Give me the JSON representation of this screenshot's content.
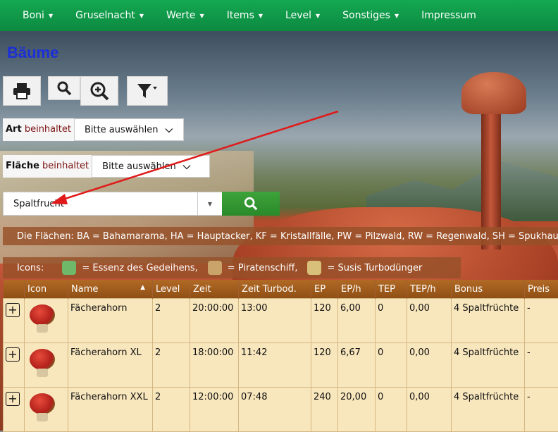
{
  "nav": {
    "items": [
      {
        "label": "Boni",
        "caret": true
      },
      {
        "label": "Gruselnacht",
        "caret": true
      },
      {
        "label": "Werte",
        "caret": true
      },
      {
        "label": "Items",
        "caret": true
      },
      {
        "label": "Level",
        "caret": true
      },
      {
        "label": "Sonstiges",
        "caret": true
      },
      {
        "label": "Impressum",
        "caret": false
      }
    ]
  },
  "page": {
    "title": "Bäume"
  },
  "toolbar": {
    "icons": [
      "print-icon",
      "search-icon",
      "zoom-in-icon",
      "filter-icon"
    ]
  },
  "filters": {
    "art": {
      "field": "Art",
      "op": "beinhaltet",
      "value": "Bitte auswählen"
    },
    "flaeche": {
      "field": "Fläche",
      "op": "beinhaltet",
      "value": "Bitte auswählen"
    }
  },
  "search": {
    "value": "Spaltfrucht"
  },
  "info": {
    "flaechen": "Die Flächen: BA = Bahamarama, HA = Hauptacker, KF = Kristallfälle, PW = Pilzwald, RW = Regenwald, SH = Spukhaus"
  },
  "icons_legend": {
    "label": "Icons:",
    "entries": [
      {
        "text": "= Essenz des Gedeihens,",
        "icon": "essence-icon",
        "color": "#6fb86a"
      },
      {
        "text": "= Piratenschiff,",
        "icon": "pirate-ship-icon",
        "color": "#c9a36a"
      },
      {
        "text": "= Susis Turbodünger",
        "icon": "fertilizer-icon",
        "color": "#d8c07a"
      }
    ]
  },
  "table": {
    "columns": [
      "",
      "Icon",
      "Name",
      "Level",
      "Zeit",
      "Zeit Turbod.",
      "EP",
      "EP/h",
      "TEP",
      "TEP/h",
      "Bonus",
      "Preis"
    ],
    "sort_column": "Name",
    "rows": [
      {
        "name": "Fächerahorn",
        "level": "2",
        "zeit": "20:00:00",
        "zeit_turbo": "13:00",
        "ep": "120",
        "eph": "6,00",
        "tep": "0",
        "teph": "0,00",
        "bonus": "4 Spaltfrüchte",
        "preis": "-"
      },
      {
        "name": "Fächerahorn XL",
        "level": "2",
        "zeit": "18:00:00",
        "zeit_turbo": "11:42",
        "ep": "120",
        "eph": "6,67",
        "tep": "0",
        "teph": "0,00",
        "bonus": "4 Spaltfrüchte",
        "preis": "-"
      },
      {
        "name": "Fächerahorn XXL",
        "level": "2",
        "zeit": "12:00:00",
        "zeit_turbo": "07:48",
        "ep": "240",
        "eph": "20,00",
        "tep": "0",
        "teph": "0,00",
        "bonus": "4 Spaltfrüchte",
        "preis": "-"
      }
    ]
  },
  "colors": {
    "nav": "#0c8a40",
    "title": "#1c2fd8",
    "table_header": "#9a561b",
    "row_bg": "#f8e6bd",
    "arrow": "#e01a1a"
  }
}
